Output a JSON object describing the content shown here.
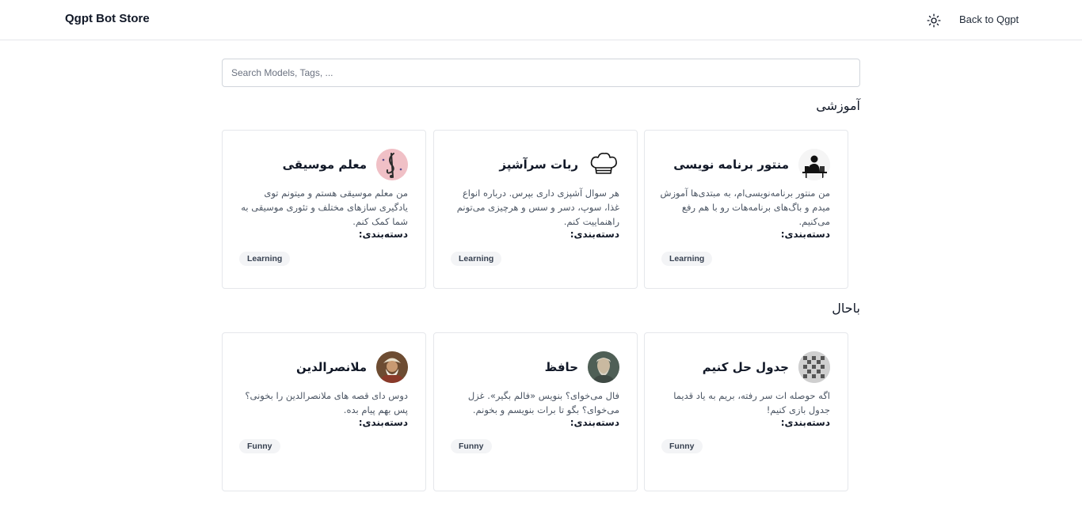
{
  "header": {
    "brand": "Qgpt Bot Store",
    "theme_icon": "sun-icon",
    "back_label": "Back to Qgpt"
  },
  "search": {
    "placeholder": "Search Models, Tags, ..."
  },
  "category_label": "دسته‌بندی:",
  "sections": [
    {
      "title": "آموزشی",
      "cards": [
        {
          "name": "منتور برنامه نویسی",
          "avatar_icon": "programmer-at-desk-icon",
          "description": "من منتور برنامه‌نویسی‌ام، به مبتدی‌ها آموزش میدم و باگ‌های برنامه‌هات رو با هم رفع می‌کنیم.",
          "tag": "Learning"
        },
        {
          "name": "ربات سرآشپز",
          "avatar_icon": "chef-hat-icon",
          "description": "هر سوال آشپزی داری بپرس. درباره انواع غذا، سوپ، دسر و سس و هرچیزی می‌تونم راهنماییت کنم.",
          "tag": "Learning"
        },
        {
          "name": "معلم موسیقی",
          "avatar_icon": "treble-clef-icon",
          "description": "من معلم موسیقی هستم و میتونم توی یادگیری سازهای مختلف و تئوری موسیقی به شما کمک کنم.",
          "tag": "Learning"
        }
      ]
    },
    {
      "title": "باحال",
      "cards": [
        {
          "name": "جدول حل کنیم",
          "avatar_icon": "crossword-grid-icon",
          "description": "اگه حوصله ات سر رفته، بریم به یاد قدیما جدول بازی کنیم!",
          "tag": "Funny"
        },
        {
          "name": "حافظ",
          "avatar_icon": "hafez-portrait-icon",
          "description": "فال می‌خوای؟ بنویس «فالم بگیر». غزل می‌خوای؟ بگو تا برات بنویسم و بخونم.",
          "tag": "Funny"
        },
        {
          "name": "ملانصرالدین",
          "avatar_icon": "mullah-nasreddin-portrait-icon",
          "description": "دوس دای قصه های ملانصرالدین را بخونی؟ پس بهم پیام بده.",
          "tag": "Funny"
        }
      ]
    }
  ]
}
